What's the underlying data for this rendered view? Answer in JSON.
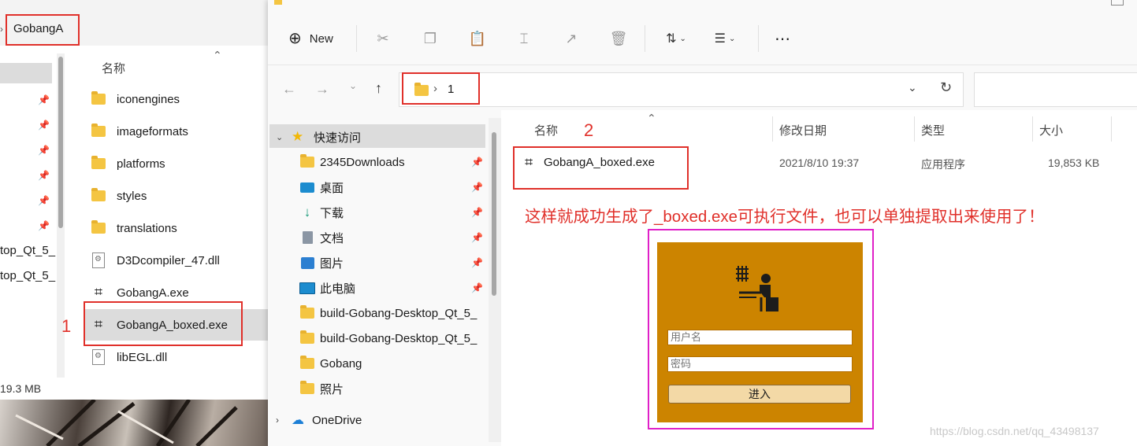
{
  "left": {
    "address": "GobangA",
    "column_name": "名称",
    "sidebar_cut": [
      "top_Qt_5_",
      "top_Qt_5_"
    ],
    "files": [
      {
        "name": "iconengines",
        "type": "folder"
      },
      {
        "name": "imageformats",
        "type": "folder"
      },
      {
        "name": "platforms",
        "type": "folder"
      },
      {
        "name": "styles",
        "type": "folder"
      },
      {
        "name": "translations",
        "type": "folder"
      },
      {
        "name": "D3Dcompiler_47.dll",
        "type": "dll"
      },
      {
        "name": "GobangA.exe",
        "type": "exe"
      },
      {
        "name": "GobangA_boxed.exe",
        "type": "exe"
      },
      {
        "name": "libEGL.dll",
        "type": "dll"
      }
    ],
    "status_size": "19.3 MB",
    "annotation_number": "1"
  },
  "right": {
    "toolbar": {
      "new_label": "New"
    },
    "breadcrumb": {
      "separator": "›",
      "folder": "1"
    },
    "nav": [
      {
        "label": "快速访问",
        "icon": "star-icon",
        "pinned": false,
        "expanded": true
      },
      {
        "label": "2345Downloads",
        "icon": "folder-icon",
        "pinned": true
      },
      {
        "label": "桌面",
        "icon": "desktop-icon",
        "pinned": true
      },
      {
        "label": "下载",
        "icon": "download-icon",
        "pinned": true
      },
      {
        "label": "文档",
        "icon": "document-icon",
        "pinned": true
      },
      {
        "label": "图片",
        "icon": "pictures-icon",
        "pinned": true
      },
      {
        "label": "此电脑",
        "icon": "computer-icon",
        "pinned": true
      },
      {
        "label": "build-Gobang-Desktop_Qt_5_",
        "icon": "folder-icon",
        "pinned": false
      },
      {
        "label": "build-Gobang-Desktop_Qt_5_",
        "icon": "folder-icon",
        "pinned": false
      },
      {
        "label": "Gobang",
        "icon": "folder-icon",
        "pinned": false
      },
      {
        "label": "照片",
        "icon": "folder-icon",
        "pinned": false
      },
      {
        "label": "OneDrive",
        "icon": "cloud-icon",
        "pinned": false
      }
    ],
    "columns": {
      "name": "名称",
      "modified": "修改日期",
      "type": "类型",
      "size": "大小"
    },
    "file": {
      "name": "GobangA_boxed.exe",
      "modified": "2021/8/10 19:37",
      "type": "应用程序",
      "size": "19,853 KB"
    },
    "annotation_number": "2",
    "annotation_text": "这样就成功生成了_boxed.exe可执行文件，也可以单独提取出来使用了！",
    "login": {
      "username_placeholder": "用户名",
      "password_placeholder": "密码",
      "enter_button": "进入",
      "bg_color": "#cc8400"
    },
    "watermark": "https://blog.csdn.net/qq_43498137"
  },
  "colors": {
    "annotation_red": "#e0302a",
    "highlight_magenta": "#e020c8"
  }
}
